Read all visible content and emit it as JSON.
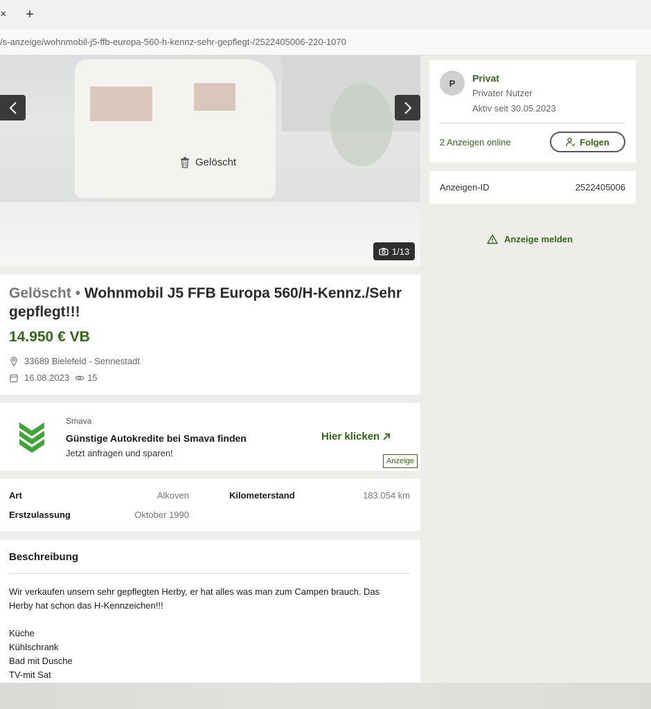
{
  "browser": {
    "close_glyph": "×",
    "newtab_glyph": "+",
    "url": "/s-anzeige/wohnmobil-j5-ffb-europa-560-h-kennz-sehr-gepflegt-/2522405006-220-1070"
  },
  "gallery": {
    "deleted_label": "Gelöscht",
    "counter": "1/13"
  },
  "listing": {
    "status": "Gelöscht",
    "separator": " • ",
    "title": "Wohnmobil J5 FFB Europa 560/H-Kennz./Sehr gepflegt!!!",
    "price": "14.950 € VB",
    "location": "33689 Bielefeld - Sennestadt",
    "date": "16.08.2023",
    "views": "15"
  },
  "ad": {
    "brand": "Smava",
    "headline": "Günstige Autokredite bei Smava finden",
    "subline": "Jetzt anfragen und sparen!",
    "cta": "Hier klicken",
    "badge": "Anzeige"
  },
  "attributes": [
    {
      "label": "Art",
      "value": "Alkoven"
    },
    {
      "label": "Kilometerstand",
      "value": "183.054 km"
    },
    {
      "label": "Erstzulassung",
      "value": "Oktober 1990"
    }
  ],
  "description": {
    "title": "Beschreibung",
    "lines": [
      "Wir verkaufen unsern sehr gepflegten Herby, er hat alles was man zum Campen brauch. Das Herby hat schon das H-Kennzeichen!!!",
      "",
      "Küche",
      "Kühlschrank",
      "Bad mit Dusche",
      "TV-mit Sat"
    ]
  },
  "seller": {
    "initial": "P",
    "name": "Privat",
    "type": "Privater Nutzer",
    "active_since": "Aktiv seit 30.05.2023",
    "ads_online": "2 Anzeigen online",
    "follow_label": "Folgen"
  },
  "ad_id": {
    "label": "Anzeigen-ID",
    "value": "2522405006"
  },
  "report": {
    "label": "Anzeige melden"
  },
  "colors": {
    "accent_green": "#326916",
    "logo_green": "#3fa535"
  }
}
